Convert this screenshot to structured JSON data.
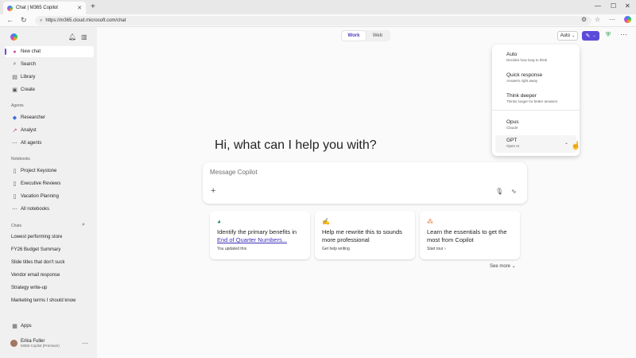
{
  "browser": {
    "tab_title": "Chat | M365 Copilot",
    "tab_close": "✕",
    "new_tab": "+",
    "url": "https://m365.cloud.microsoft.com/chat"
  },
  "sidebar": {
    "primary": [
      {
        "icon": "pencil-icon",
        "glyph": "✎",
        "label": "New chat"
      },
      {
        "icon": "search-icon",
        "glyph": "⌕",
        "label": "Search"
      },
      {
        "icon": "library-icon",
        "glyph": "▤",
        "label": "Library"
      },
      {
        "icon": "create-icon",
        "glyph": "▣",
        "label": "Create"
      }
    ],
    "agents_heading": "Agents",
    "agents": [
      {
        "icon": "researcher-icon",
        "glyph": "◆",
        "label": "Researcher"
      },
      {
        "icon": "analyst-icon",
        "glyph": "↗",
        "label": "Analyst"
      },
      {
        "icon": "more-icon",
        "glyph": "⋯",
        "label": "All agents"
      }
    ],
    "notebooks_heading": "Notebooks",
    "notebooks": [
      {
        "icon": "notebook-icon",
        "glyph": "▯",
        "label": "Project Keystone"
      },
      {
        "icon": "notebook-icon",
        "glyph": "▯",
        "label": "Executive Reviews"
      },
      {
        "icon": "notebook-icon",
        "glyph": "▯",
        "label": "Vacation Planning"
      },
      {
        "icon": "more-icon",
        "glyph": "⋯",
        "label": "All notebooks"
      }
    ],
    "chats_heading": "Chats",
    "chats": [
      "Lowest performing store",
      "FY26 Budget Summary",
      "Slide titles that don't suck",
      "Vendor email response",
      "Strategy write-up",
      "Marketing terms I should know"
    ],
    "apps_label": "Apps",
    "user_name": "Erika Fuller",
    "user_plan": "M365 Copilot (Premium)"
  },
  "main": {
    "toggle": {
      "work": "Work",
      "web": "Web"
    },
    "model_button": "Auto",
    "greeting": "Hi, what can I help you with?",
    "composer_placeholder": "Message Copilot",
    "cards": [
      {
        "pre": "Identify the primary benefits in ",
        "link": "End of Quarter Numbers...",
        "sub": "You updated this"
      },
      {
        "pre": "Help me rewrite this to sounds more professional",
        "link": "",
        "sub": "Get help writing"
      },
      {
        "pre": "Learn the essentials to get the most from Copilot",
        "link": "",
        "sub": "Start tour ›"
      }
    ],
    "see_more": "See more ⌄"
  },
  "dropdown": {
    "options": [
      {
        "name": "Auto",
        "desc": "Decides how long to think"
      },
      {
        "name": "Quick response",
        "desc": "Answers right away"
      },
      {
        "name": "Think deeper",
        "desc": "Thinks longer for better answers"
      },
      {
        "name": "Opus",
        "desc": "Claude"
      },
      {
        "name": "GPT",
        "desc": "Open AI"
      }
    ]
  },
  "colors": {
    "accent": "#5b4ad9",
    "link": "#3c2fb8"
  }
}
